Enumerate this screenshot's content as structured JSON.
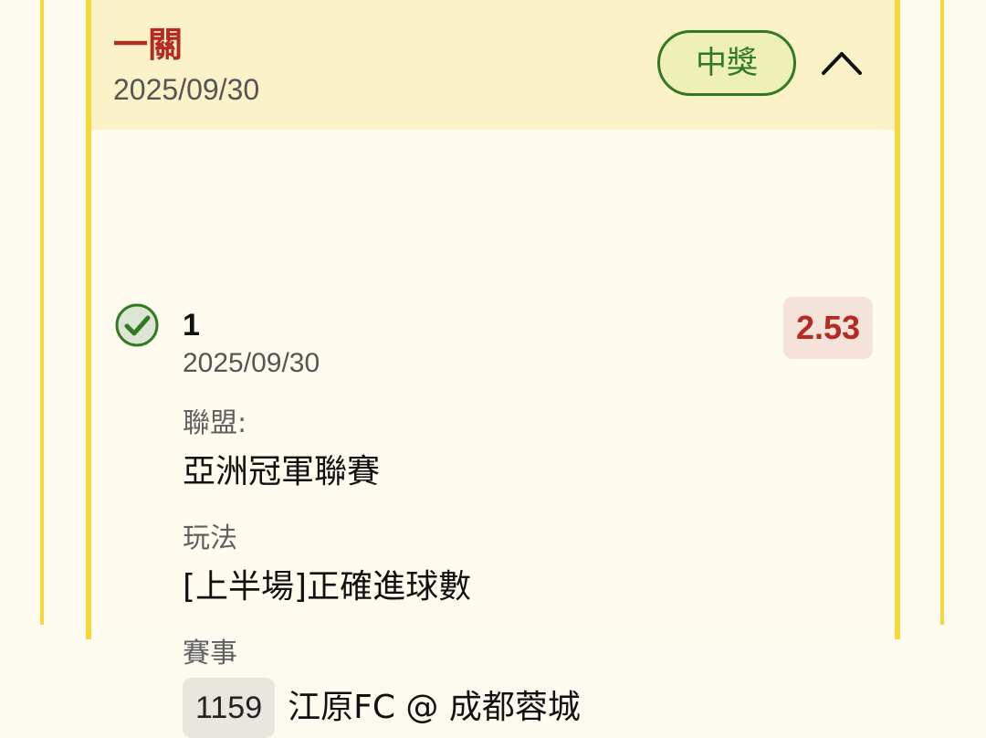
{
  "bet": {
    "type_label": "一關",
    "date": "2025/09/30",
    "status_label": "中獎",
    "collapse_icon": "chevron-up-icon"
  },
  "selection": {
    "status_icon": "check-circle-icon",
    "number": "1",
    "date": "2025/09/30",
    "odds": "2.53",
    "league_label": "聯盟:",
    "league_value": "亞洲冠軍聯賽",
    "market_label": "玩法",
    "market_value": "[上半場]正確進球數",
    "event_label": "賽事",
    "event_id": "1159",
    "event_name": "江原FC @ 成都蓉城"
  },
  "colors": {
    "accent_yellow": "#f6d83a",
    "header_bg": "#fcf2c8",
    "win_green": "#2f7a23",
    "red_text": "#b52a22",
    "odds_bg": "#f5e2d8"
  }
}
